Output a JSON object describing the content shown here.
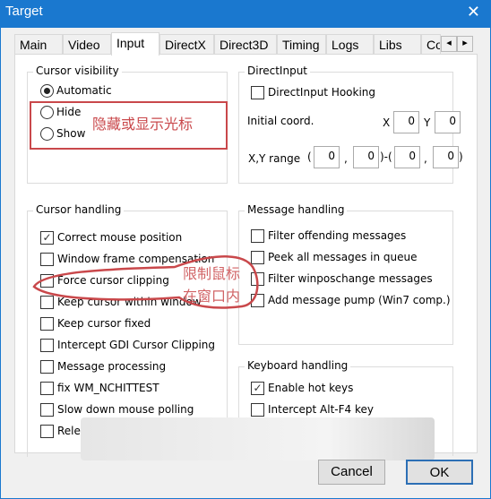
{
  "window": {
    "title": "Target",
    "close_icon": "close-icon"
  },
  "tabs": [
    "Main",
    "Video",
    "Input",
    "DirectX",
    "Direct3D",
    "Timing",
    "Logs",
    "Libs",
    "Co"
  ],
  "tab_scroll": {
    "left": "◂",
    "right": "▸"
  },
  "cursor_visibility": {
    "label": "Cursor visibility",
    "options": [
      {
        "label": "Automatic",
        "selected": true
      },
      {
        "label": "Hide",
        "selected": false
      },
      {
        "label": "Show",
        "selected": false
      }
    ]
  },
  "direct_input": {
    "label": "DirectInput",
    "hooking": {
      "label": "DirectInput Hooking",
      "checked": false
    },
    "initial_coord_label": "Initial coord.",
    "x_label": "X",
    "y_label": "Y",
    "x": "0",
    "y": "0",
    "range_label": "X,Y range",
    "range": [
      "0",
      "0",
      "0",
      "0"
    ],
    "paren_open": "(",
    "comma": ",",
    "mid": ")-(",
    "paren_close": ")"
  },
  "cursor_handling": {
    "label": "Cursor handling",
    "items": [
      {
        "label": "Correct mouse position",
        "checked": true
      },
      {
        "label": "Window frame compensation",
        "checked": false
      },
      {
        "label": "Force cursor clipping",
        "checked": false
      },
      {
        "label": "Keep cursor within window",
        "checked": false
      },
      {
        "label": "Keep cursor fixed",
        "checked": false
      },
      {
        "label": "Intercept GDI Cursor Clipping",
        "checked": false
      },
      {
        "label": "Message processing",
        "checked": false
      },
      {
        "label": "fix WM_NCHITTEST",
        "checked": false
      },
      {
        "label": "Slow down mouse polling",
        "checked": false
      },
      {
        "label": "Relea",
        "checked": false
      }
    ]
  },
  "message_handling": {
    "label": "Message handling",
    "items": [
      {
        "label": "Filter offending messages",
        "checked": false
      },
      {
        "label": "Peek all messages in queue",
        "checked": false
      },
      {
        "label": "Filter winposchange messages",
        "checked": false
      },
      {
        "label": "Add message pump (Win7 comp.)",
        "checked": false
      }
    ]
  },
  "keyboard_handling": {
    "label": "Keyboard handling",
    "items": [
      {
        "label": "Enable hot keys",
        "checked": true
      },
      {
        "label": "Intercept Alt-F4 key",
        "checked": false
      }
    ]
  },
  "buttons": {
    "cancel": "Cancel",
    "ok": "OK"
  },
  "annotations": {
    "visibility_note": "隐藏或显示光标",
    "clip_note_line1": "限制鼠标",
    "clip_note_line2": "在窗口内",
    "color": "#c9484b"
  }
}
